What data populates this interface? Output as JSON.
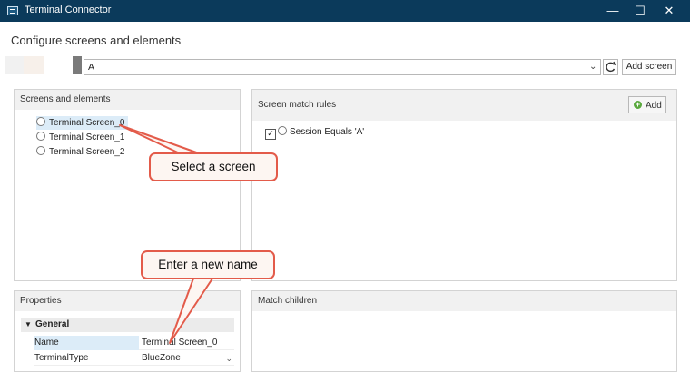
{
  "window": {
    "title": "Terminal Connector",
    "minimize": "—",
    "maximize": "☐",
    "close": "✕"
  },
  "page_title": "Configure screens and elements",
  "toolbar": {
    "screen_value": "A",
    "chevron": "⌄",
    "refresh": "⟳",
    "add_screen": "Add screen"
  },
  "screens_panel": {
    "header": "Screens and elements",
    "items": [
      "Terminal Screen_0",
      "Terminal Screen_1",
      "Terminal Screen_2"
    ]
  },
  "rules_panel": {
    "header": "Screen match rules",
    "add": "Add",
    "add_icon": "+",
    "rule": {
      "checked": "✓",
      "label": "Session Equals 'A'"
    }
  },
  "properties_panel": {
    "header": "Properties",
    "group": "General",
    "group_caret": "▼",
    "rows": [
      {
        "key": "Name",
        "value": "Terminal Screen_0"
      },
      {
        "key": "TerminalType",
        "value": "BlueZone"
      }
    ],
    "type_chevron": "⌄"
  },
  "children_panel": {
    "header": "Match children"
  },
  "callouts": {
    "select": "Select a screen",
    "name": "Enter a new name"
  },
  "colors": {
    "titlebar": "#0b3a5b",
    "callout_border": "#e35b4a",
    "selection": "#dcecf8",
    "add_icon": "#5aa93e"
  }
}
